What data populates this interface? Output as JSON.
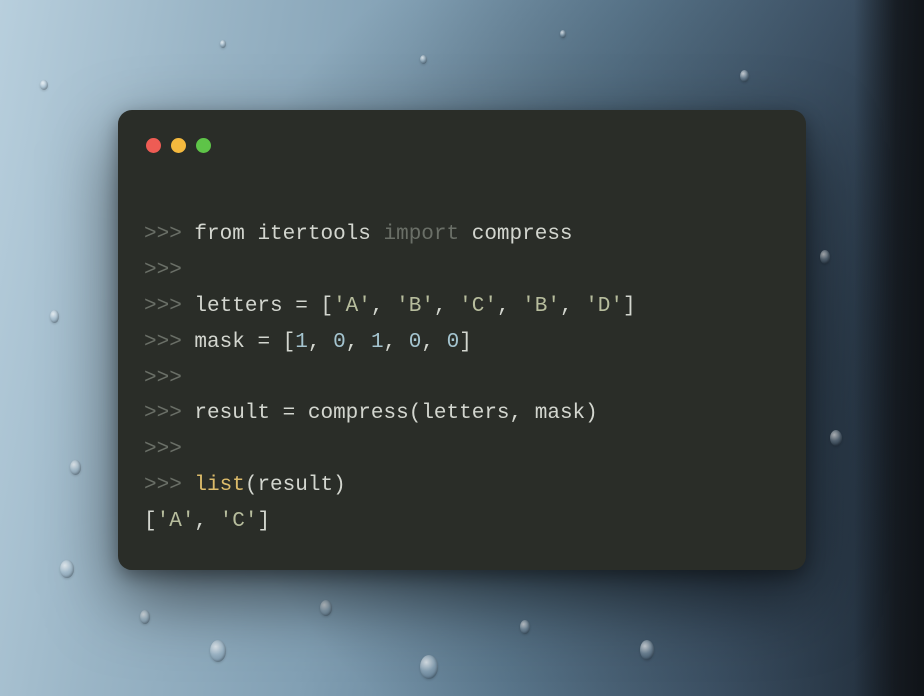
{
  "colors": {
    "window_bg": "#2a2d28",
    "close": "#ee5c54",
    "min": "#f4b93e",
    "max": "#5ec448",
    "prompt": "#6a6f67",
    "text": "#d3d6cf",
    "string": "#b7bd9d",
    "number": "#a4c4cf",
    "builtin": "#dcbb6a"
  },
  "code": {
    "p": ">>> ",
    "pe": ">>>",
    "l1": {
      "from": "from",
      "sp1": " ",
      "mod": "itertools",
      "sp2": " ",
      "import": "import",
      "sp3": " ",
      "name": "compress"
    },
    "l3": {
      "var": "letters",
      "sp1": " ",
      "eq": "=",
      "sp2": " ",
      "lb": "[",
      "s1": "'A'",
      "c1": ", ",
      "s2": "'B'",
      "c2": ", ",
      "s3": "'C'",
      "c3": ", ",
      "s4": "'B'",
      "c4": ", ",
      "s5": "'D'",
      "rb": "]"
    },
    "l4": {
      "var": "mask",
      "sp1": " ",
      "eq": "=",
      "sp2": " ",
      "lb": "[",
      "n1": "1",
      "c1": ", ",
      "n2": "0",
      "c2": ", ",
      "n3": "1",
      "c3": ", ",
      "n4": "0",
      "c4": ", ",
      "n5": "0",
      "rb": "]"
    },
    "l6": {
      "var": "result",
      "sp1": " ",
      "eq": "=",
      "sp2": " ",
      "fn": "compress",
      "lp": "(",
      "a1": "letters",
      "cm": ", ",
      "a2": "mask",
      "rp": ")"
    },
    "l8": {
      "fn": "list",
      "lp": "(",
      "arg": "result",
      "rp": ")"
    },
    "l9": {
      "lb": "[",
      "s1": "'A'",
      "c1": ", ",
      "s2": "'C'",
      "rb": "]"
    }
  }
}
